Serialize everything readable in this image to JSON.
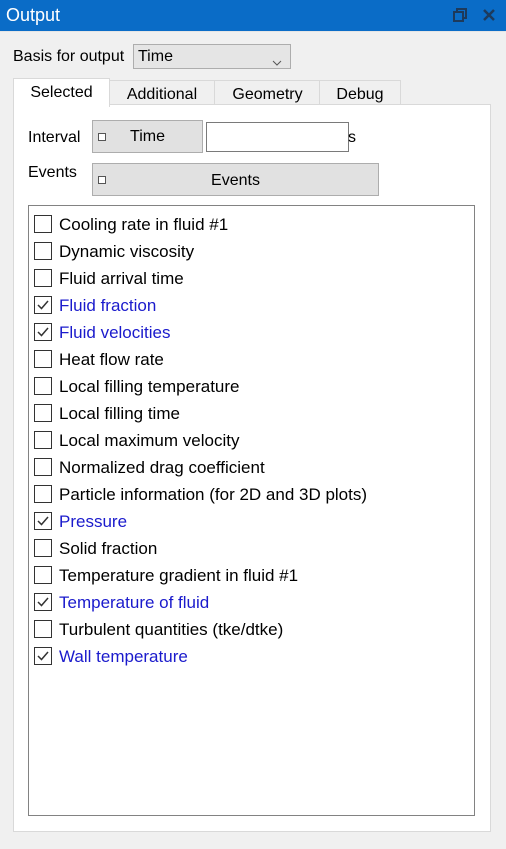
{
  "window": {
    "title": "Output"
  },
  "basis": {
    "label": "Basis for output",
    "selected": "Time"
  },
  "tabs": [
    {
      "label": "Selected",
      "active": true
    },
    {
      "label": "Additional",
      "active": false
    },
    {
      "label": "Geometry",
      "active": false
    },
    {
      "label": "Debug",
      "active": false
    }
  ],
  "interval": {
    "label": "Interval",
    "button_label": "Time",
    "value": "",
    "unit": "s"
  },
  "events": {
    "label": "Events",
    "button_label": "Events"
  },
  "colors": {
    "titlebar": "#0a6cc7",
    "checked_text": "#1a1acc"
  },
  "outputs": [
    {
      "label": "Cooling rate in fluid #1",
      "checked": false
    },
    {
      "label": "Dynamic viscosity",
      "checked": false
    },
    {
      "label": "Fluid arrival time",
      "checked": false
    },
    {
      "label": "Fluid fraction",
      "checked": true
    },
    {
      "label": "Fluid velocities",
      "checked": true
    },
    {
      "label": "Heat flow rate",
      "checked": false
    },
    {
      "label": "Local filling temperature",
      "checked": false
    },
    {
      "label": "Local filling time",
      "checked": false
    },
    {
      "label": "Local maximum velocity",
      "checked": false
    },
    {
      "label": "Normalized drag coefficient",
      "checked": false
    },
    {
      "label": "Particle information (for 2D and 3D plots)",
      "checked": false
    },
    {
      "label": "Pressure",
      "checked": true
    },
    {
      "label": "Solid fraction",
      "checked": false
    },
    {
      "label": "Temperature gradient in fluid #1",
      "checked": false
    },
    {
      "label": "Temperature of fluid",
      "checked": true
    },
    {
      "label": "Turbulent quantities (tke/dtke)",
      "checked": false
    },
    {
      "label": "Wall temperature",
      "checked": true
    }
  ]
}
